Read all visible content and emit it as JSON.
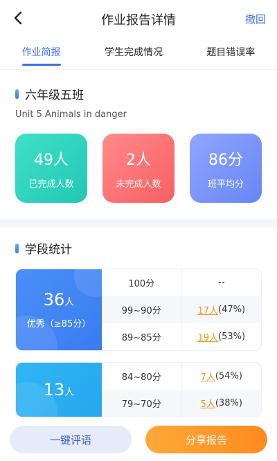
{
  "header": {
    "title": "作业报告详情",
    "action": "撤回"
  },
  "tabs": [
    {
      "label": "作业简报",
      "active": true
    },
    {
      "label": "学生完成情况",
      "active": false
    },
    {
      "label": "题目错误率",
      "active": false
    }
  ],
  "class_info": {
    "name": "六年级五班",
    "unit": "Unit 5 Animals in danger"
  },
  "stats": [
    {
      "value": "49人",
      "label": "已完成人数",
      "color": "#2ccfb9"
    },
    {
      "value": "2人",
      "label": "未完成人数",
      "color": "#f96b6e"
    },
    {
      "value": "86分",
      "label": "班平均分",
      "color": "#7590f6"
    }
  ],
  "grade_stats": {
    "title": "学段统计",
    "groups": [
      {
        "count": "36",
        "unit": "人",
        "level": "优秀（≥85分）",
        "rows": [
          {
            "range": "100分",
            "result": "--",
            "link": ""
          },
          {
            "range": "99~90分",
            "result": "17人",
            "pct": "(47%)"
          },
          {
            "range": "89~85分",
            "result": "19人",
            "pct": "(53%)"
          }
        ]
      },
      {
        "count": "13",
        "unit": "人",
        "level": "",
        "rows": [
          {
            "range": "84~80分",
            "result": "7人",
            "pct": "(54%)"
          },
          {
            "range": "79~70分",
            "result": "5人",
            "pct": "(38%)"
          }
        ]
      }
    ]
  },
  "buttons": {
    "comment": "一键评语",
    "share": "分享报告"
  }
}
